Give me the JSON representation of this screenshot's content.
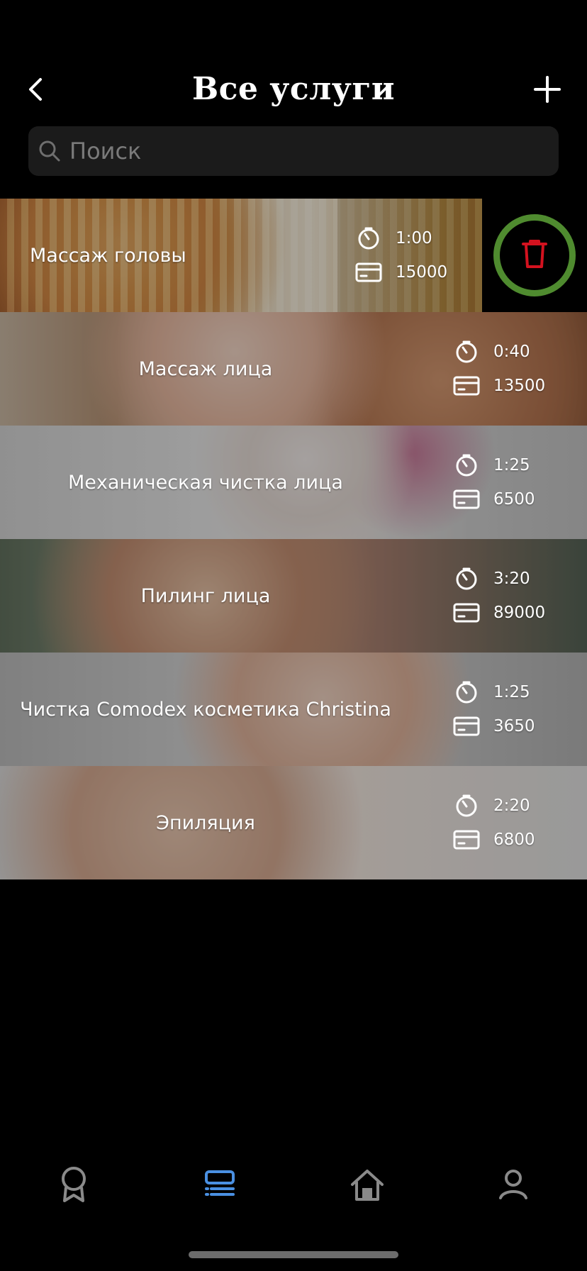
{
  "header": {
    "title": "Все услуги"
  },
  "search": {
    "placeholder": "Поиск"
  },
  "services": [
    {
      "name": "Массаж головы",
      "time": "1:00",
      "price": "15000"
    },
    {
      "name": "Массаж лица",
      "time": "0:40",
      "price": "13500"
    },
    {
      "name": "Механическая чистка лица",
      "time": "1:25",
      "price": "6500"
    },
    {
      "name": "Пилинг лица",
      "time": "3:20",
      "price": "89000"
    },
    {
      "name": "Чистка Comodex косметика Christina",
      "time": "1:25",
      "price": "3650"
    },
    {
      "name": "Эпиляция",
      "time": "2:20",
      "price": "6800"
    }
  ],
  "icons": {
    "back": "chevron-left-icon",
    "add": "plus-icon",
    "search": "search-icon",
    "time": "timer-icon",
    "price": "card-icon",
    "delete": "trash-icon",
    "nav": [
      "badge-icon",
      "list-icon",
      "home-icon",
      "profile-icon"
    ]
  },
  "colors": {
    "background": "#000000",
    "active_nav": "#4a90e2",
    "inactive_nav": "#8a8a8a",
    "delete_ring": "#4f8b2f",
    "delete_icon": "#d3121f"
  }
}
